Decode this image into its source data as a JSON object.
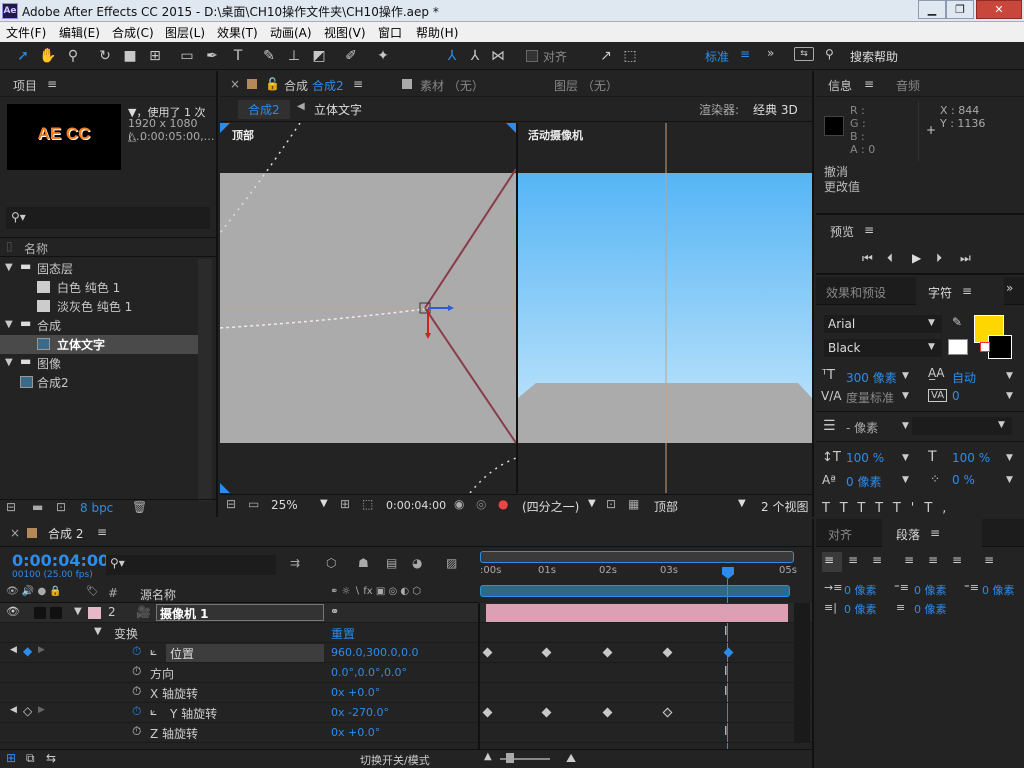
{
  "window": {
    "icon": "Ae",
    "title": "Adobe After Effects CC 2015 - D:\\桌面\\CH10操作文件夹\\CH10操作.aep *"
  },
  "menu": [
    "文件(F)",
    "编辑(E)",
    "合成(C)",
    "图层(L)",
    "效果(T)",
    "动画(A)",
    "视图(V)",
    "窗口",
    "帮助(H)"
  ],
  "toolbar": {
    "align_label": "对齐",
    "workspace": "标准",
    "search_help": "搜索帮助"
  },
  "project": {
    "tab": "项目",
    "thumb_text": "AE CC",
    "info_line1": "▼，使用了 1 次",
    "info_line2": "1920 x 1080 (…",
    "info_line3": "△ 0:00:05:00,…",
    "col_name": "名称",
    "items": [
      {
        "label": "固态层",
        "type": "folder"
      },
      {
        "label": "白色 纯色 1",
        "type": "solid"
      },
      {
        "label": "淡灰色 纯色 1",
        "type": "solid"
      },
      {
        "label": "合成",
        "type": "folder"
      },
      {
        "label": "立体文字",
        "type": "comp"
      },
      {
        "label": "图像",
        "type": "folder"
      },
      {
        "label": "合成2",
        "type": "comp"
      }
    ],
    "bpc": "8 bpc"
  },
  "viewer": {
    "tab_comp_prefix": "合成",
    "tab_comp": "合成2",
    "tab_footage": "素材 （无）",
    "tab_layer": "图层 （无）",
    "crumb_active": "合成2",
    "crumb_next": "立体文字",
    "renderer_label": "渲染器:",
    "renderer_value": "经典 3D",
    "view_top": "顶部",
    "view_camera": "活动摄像机",
    "zoom": "25%",
    "timecode": "0:00:04:00",
    "resolution": "(四分之一)",
    "view_select": "顶部",
    "views": "2 个视图"
  },
  "info": {
    "tab": "信息",
    "tab2": "音频",
    "r": "R :",
    "g": "G :",
    "b": "B :",
    "a": "A : 0",
    "x": "X : 844",
    "y": "Y : 1136",
    "undo1": "撤消",
    "undo2": "更改值"
  },
  "preview": {
    "tab": "预览"
  },
  "character": {
    "tab1": "效果和预设",
    "tab2": "字符",
    "font": "Arial",
    "style": "Black",
    "size": "300 像素",
    "leading": "自动",
    "kerning": "度量标准",
    "tracking": "0",
    "stroke": "- 像素",
    "vscale": "100 %",
    "hscale": "100 %",
    "baseline": "0 像素",
    "tsume": "0 %",
    "fill_color": "#ffd700"
  },
  "paragraph": {
    "tab1": "对齐",
    "tab2": "段落",
    "indent_left": "0 像素",
    "indent_right": "0 像素",
    "first_line": "0 像素",
    "space_before": "0 像素",
    "space_after": "0 像素"
  },
  "timeline": {
    "tab": "合成 2",
    "timecode": "0:00:04:00",
    "fps": "00100 (25.00 fps)",
    "col_source": "源名称",
    "ruler": [
      ":00s",
      "01s",
      "02s",
      "03s",
      "05s"
    ],
    "layer_num": "2",
    "layer_name": "摄像机 1",
    "transform": "变换",
    "reset": "重置",
    "props": [
      {
        "name": "位置",
        "value": "960.0,300.0,0.0"
      },
      {
        "name": "方向",
        "value": "0.0°,0.0°,0.0°"
      },
      {
        "name": "X 轴旋转",
        "value": "0x +0.0°"
      },
      {
        "name": "Y 轴旋转",
        "value": "0x -270.0°"
      },
      {
        "name": "Z 轴旋转",
        "value": "0x +0.0°"
      }
    ],
    "toggle_label": "切换开关/模式"
  }
}
